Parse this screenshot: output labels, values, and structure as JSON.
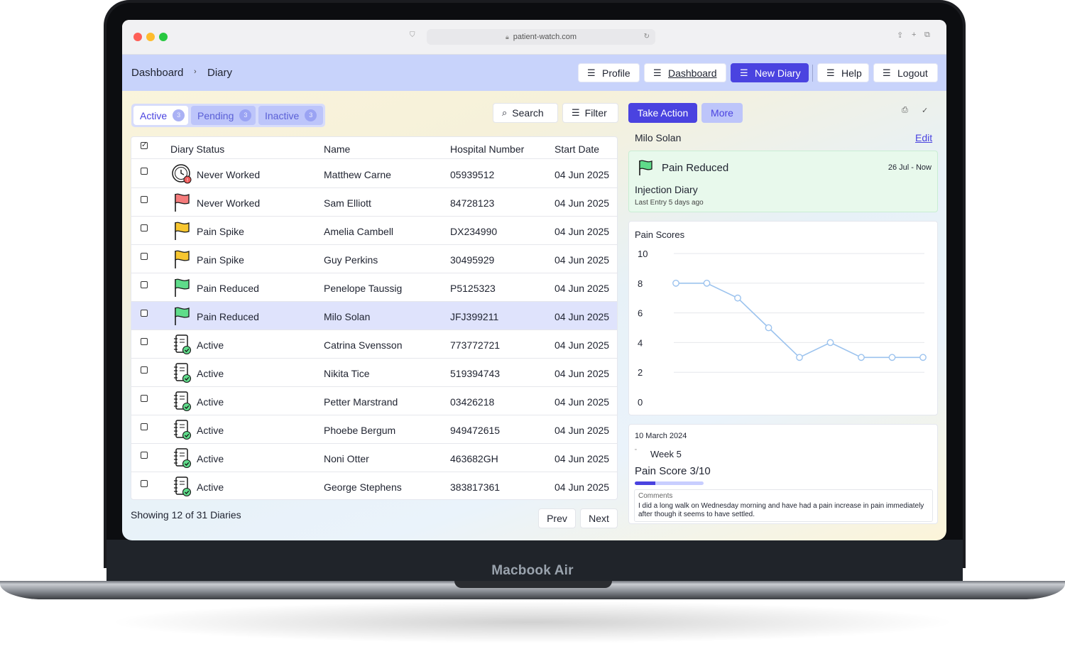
{
  "device": {
    "label": "Macbook Air"
  },
  "browser": {
    "url": "patient-watch.com"
  },
  "header": {
    "breadcrumb": [
      "Dashboard",
      "Diary"
    ],
    "nav": [
      {
        "label": "Profile"
      },
      {
        "label": "Dashboard"
      },
      {
        "label": "New Diary"
      },
      {
        "label": "Help"
      },
      {
        "label": "Logout"
      }
    ]
  },
  "tabs": [
    {
      "label": "Active",
      "count": "3"
    },
    {
      "label": "Pending",
      "count": "3"
    },
    {
      "label": "Inactive",
      "count": "3"
    }
  ],
  "toolbar": {
    "search_label": "Search",
    "filter_label": "Filter"
  },
  "table": {
    "headers": {
      "status": "Diary Status",
      "name": "Name",
      "hospital": "Hospital Number",
      "start": "Start Date"
    },
    "rows": [
      {
        "status": "Never Worked",
        "icon": "clock-alert-icon",
        "name": "Matthew Carne",
        "hospital": "05939512",
        "start": "04 Jun 2025"
      },
      {
        "status": "Never Worked",
        "icon": "red-flag-icon",
        "name": "Sam Elliott",
        "hospital": "84728123",
        "start": "04 Jun 2025"
      },
      {
        "status": "Pain Spike",
        "icon": "yellow-flag-icon",
        "name": "Amelia Cambell",
        "hospital": "DX234990",
        "start": "04 Jun 2025"
      },
      {
        "status": "Pain Spike",
        "icon": "yellow-flag-icon",
        "name": "Guy Perkins",
        "hospital": "30495929",
        "start": "04 Jun 2025"
      },
      {
        "status": "Pain Reduced",
        "icon": "green-flag-icon",
        "name": "Penelope Taussig",
        "hospital": "P5125323",
        "start": "04 Jun 2025"
      },
      {
        "status": "Pain Reduced",
        "icon": "green-flag-icon",
        "name": "Milo Solan",
        "hospital": "JFJ399211",
        "start": "04 Jun 2025"
      },
      {
        "status": "Active",
        "icon": "diary-check-icon",
        "name": "Catrina Svensson",
        "hospital": "773772721",
        "start": "04 Jun 2025"
      },
      {
        "status": "Active",
        "icon": "diary-check-icon",
        "name": "Nikita Tice",
        "hospital": "519394743",
        "start": "04 Jun 2025"
      },
      {
        "status": "Active",
        "icon": "diary-check-icon",
        "name": "Petter Marstrand",
        "hospital": "03426218",
        "start": "04 Jun 2025"
      },
      {
        "status": "Active",
        "icon": "diary-check-icon",
        "name": "Phoebe Bergum",
        "hospital": "949472615",
        "start": "04 Jun 2025"
      },
      {
        "status": "Active",
        "icon": "diary-check-icon",
        "name": "Noni Otter",
        "hospital": "463682GH",
        "start": "04 Jun 2025"
      },
      {
        "status": "Active",
        "icon": "diary-check-icon",
        "name": "George Stephens",
        "hospital": "383817361",
        "start": "04 Jun 2025"
      }
    ],
    "selected_index": 5
  },
  "footer": {
    "showing": "Showing 12 of 31 Diaries",
    "prev": "Prev",
    "next": "Next"
  },
  "panel": {
    "take_action": "Take Action",
    "more": "More",
    "patient_name": "Milo Solan",
    "edit": "Edit",
    "status_card": {
      "title": "Pain Reduced",
      "range": "26 Jul - Now",
      "type": "Injection Diary",
      "last_entry": "Last Entry 5 days ago",
      "color": "#4fd77e"
    },
    "entry": {
      "date": "10 March 2024",
      "week": "Week 5",
      "score": "Pain Score 3/10",
      "score_fraction": 0.3,
      "comments_label": "Comments",
      "comments": "I did a long walk on Wednesday morning and have had a pain increase in pain immediately after though it seems to have settled."
    }
  },
  "chart_data": {
    "type": "line",
    "title": "Pain Scores",
    "ylim": [
      0,
      10
    ],
    "yticks": [
      0,
      2,
      4,
      6,
      8,
      10
    ],
    "grid": true,
    "series": [
      {
        "values": [
          8,
          8,
          7,
          5,
          3,
          4,
          3,
          3,
          3
        ]
      }
    ],
    "color": "#9cc3ee"
  },
  "colors": {
    "accent": "#4a43e0",
    "header_bg": "#c8d3fb",
    "row_selected": "#dfe3fc"
  }
}
